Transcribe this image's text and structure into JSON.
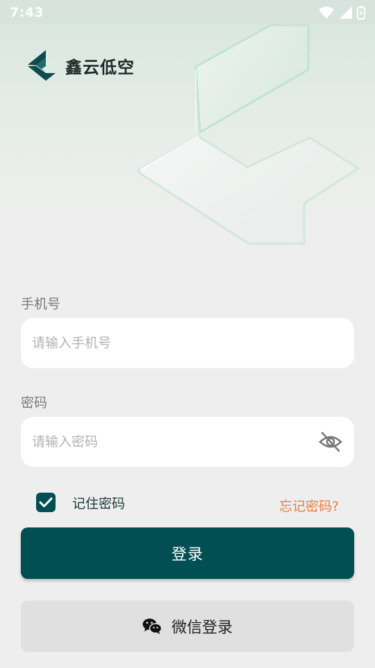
{
  "status_bar": {
    "time": "7:43",
    "icons": [
      "wifi-icon",
      "signal-icon",
      "battery-icon"
    ]
  },
  "brand": {
    "name": "鑫云低空",
    "logo_icon": "brand-logo-icon",
    "color": "#024f53"
  },
  "form": {
    "phone": {
      "label": "手机号",
      "placeholder": "请输入手机号",
      "value": ""
    },
    "password": {
      "label": "密码",
      "placeholder": "请输入密码",
      "value": "",
      "toggle_icon": "eye-off-icon"
    },
    "remember": {
      "label": "记住密码",
      "checked": true
    },
    "forgot_label": "忘记密码?"
  },
  "actions": {
    "login_label": "登录",
    "wechat_label": "微信登录",
    "wechat_icon": "wechat-icon"
  },
  "colors": {
    "primary": "#024f53",
    "accent": "#ef7c3d",
    "background": "#eeeeee",
    "secondary_button": "#e0e0e0"
  }
}
